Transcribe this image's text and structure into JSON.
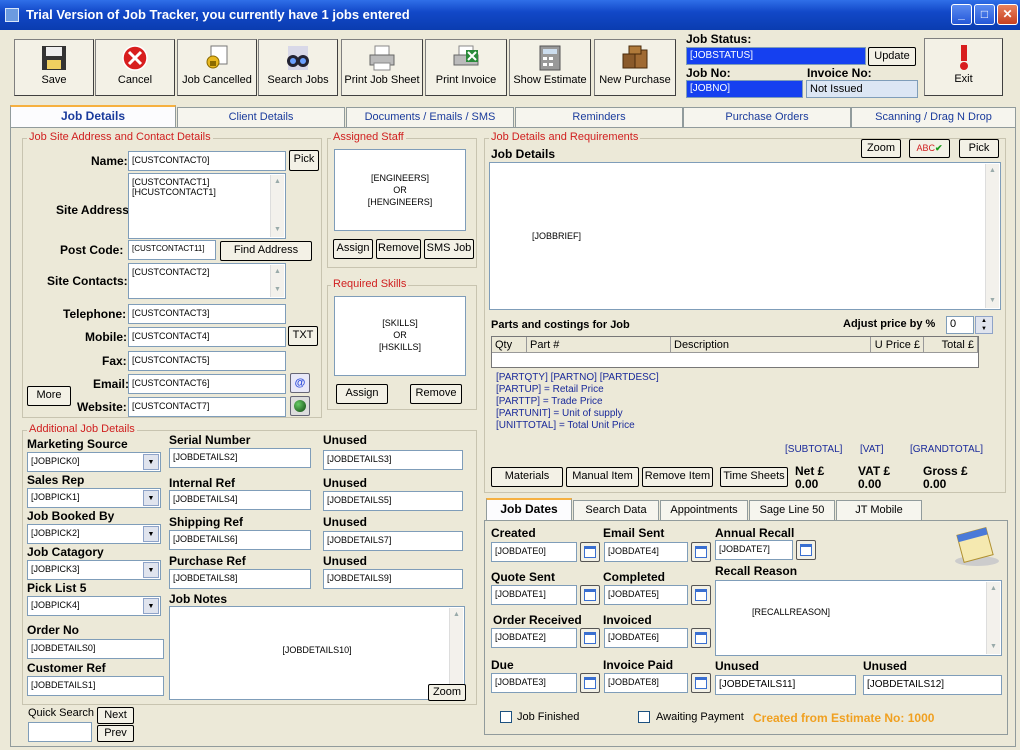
{
  "window": {
    "title": "Trial Version of Job Tracker, you currently have 1 jobs entered",
    "min": "_",
    "max": "□",
    "close": "✕"
  },
  "toolbar": {
    "save": "Save",
    "cancel": "Cancel",
    "job_cancelled": "Job Cancelled",
    "search_jobs": "Search Jobs",
    "print_job_sheet": "Print Job Sheet",
    "print_invoice": "Print Invoice",
    "show_estimate": "Show Estimate",
    "new_purchase": "New Purchase",
    "exit": "Exit"
  },
  "status": {
    "job_status_label": "Job Status:",
    "job_status_value": "[JOBSTATUS]",
    "update": "Update",
    "job_no_label": "Job No:",
    "job_no_value": "[JOBNO]",
    "invoice_no_label": "Invoice No:",
    "invoice_no_value": "Not Issued"
  },
  "tabs": [
    "Job Details",
    "Client Details",
    "Documents / Emails / SMS",
    "Reminders",
    "Purchase Orders",
    "Scanning / Drag N Drop"
  ],
  "site": {
    "title": "Job Site Address and Contact Details",
    "name_label": "Name:",
    "name": "[CUSTCONTACT0]",
    "pick": "Pick",
    "site_address_label": "Site Address",
    "addr1": "[CUSTCONTACT1]",
    "addr2": "[HCUSTCONTACT1]",
    "postcode_label": "Post Code:",
    "postcode": "[CUSTCONTACT11]",
    "find_address": "Find Address",
    "site_contacts_label": "Site Contacts:",
    "site_contacts": "[CUSTCONTACT2]",
    "telephone_label": "Telephone:",
    "telephone": "[CUSTCONTACT3]",
    "mobile_label": "Mobile:",
    "mobile": "[CUSTCONTACT4]",
    "txt": "TXT",
    "fax_label": "Fax:",
    "fax": "[CUSTCONTACT5]",
    "email_label": "Email:",
    "email": "[CUSTCONTACT6]",
    "website_label": "Website:",
    "website": "[CUSTCONTACT7]",
    "more": "More"
  },
  "staff": {
    "title": "Assigned Staff",
    "l1": "[ENGINEERS]",
    "l2": "OR",
    "l3": "[HENGINEERS]",
    "assign": "Assign",
    "remove": "Remove",
    "sms_job": "SMS Job"
  },
  "skills": {
    "title": "Required Skills",
    "l1": "[SKILLS]",
    "l2": "OR",
    "l3": "[HSKILLS]",
    "assign": "Assign",
    "remove": "Remove"
  },
  "additional": {
    "title": "Additional Job Details",
    "marketing_label": "Marketing Source",
    "marketing": "[JOBPICK0]",
    "sales_label": "Sales Rep",
    "sales": "[JOBPICK1]",
    "booked_label": "Job Booked By",
    "booked": "[JOBPICK2]",
    "category_label": "Job Catagory",
    "category": "[JOBPICK3]",
    "pick5_label": "Pick List 5",
    "pick5": "[JOBPICK4]",
    "order_label": "Order No",
    "order": "[JOBDETAILS0]",
    "customer_ref_label": "Customer Ref",
    "customer_ref": "[JOBDETAILS1]",
    "serial_label": "Serial Number",
    "serial": "[JOBDETAILS2]",
    "internal_label": "Internal Ref",
    "internal": "[JOBDETAILS4]",
    "shipping_label": "Shipping Ref",
    "shipping": "[JOBDETAILS6]",
    "purchase_label": "Purchase Ref",
    "purchase": "[JOBDETAILS8]",
    "unused_label": "Unused",
    "unused1": "[JOBDETAILS3]",
    "unused2": "[JOBDETAILS5]",
    "unused3": "[JOBDETAILS7]",
    "unused4": "[JOBDETAILS9]",
    "notes_label": "Job Notes",
    "notes": "[JOBDETAILS10]",
    "zoom": "Zoom"
  },
  "quick": {
    "label": "Quick Search",
    "next": "Next",
    "prev": "Prev"
  },
  "jobreq": {
    "title": "Job Details and Requirements",
    "job_details_label": "Job Details",
    "zoom": "Zoom",
    "abc": "ABC",
    "pick": "Pick",
    "brief": "[JOBBRIEF]"
  },
  "parts": {
    "title": "Parts and costings for Job",
    "adjust_label": "Adjust price by %",
    "adjust": "0",
    "headers": [
      "Qty",
      "Part #",
      "Description",
      "U Price £",
      "Total £"
    ],
    "legend": [
      "[PARTQTY]  [PARTNO]  [PARTDESC]",
      "[PARTUP] = Retail Price",
      "[PARTTP] = Trade Price",
      "[PARTUNIT] = Unit of supply",
      "[UNITTOTAL] = Total Unit Price"
    ],
    "subtotal": "[SUBTOTAL]",
    "vat": "[VAT]",
    "grandtotal": "[GRANDTOTAL]",
    "materials": "Materials",
    "manual_item": "Manual Item",
    "remove_item": "Remove Item",
    "time_sheets": "Time Sheets",
    "net_label": "Net £",
    "net": "0.00",
    "vat_label": "VAT £",
    "vat_value": "0.00",
    "gross_label": "Gross £",
    "gross": "0.00"
  },
  "subtabs": [
    "Job Dates",
    "Search Data",
    "Appointments",
    "Sage Line 50",
    "JT Mobile"
  ],
  "dates": {
    "created_label": "Created",
    "created": "[JOBDATE0]",
    "email_sent_label": "Email Sent",
    "email_sent": "[JOBDATE4]",
    "annual_label": "Annual Recall",
    "annual": "[JOBDATE7]",
    "quote_label": "Quote Sent",
    "quote": "[JOBDATE1]",
    "completed_label": "Completed",
    "completed": "[JOBDATE5]",
    "recall_reason_label": "Recall Reason",
    "recall_reason": "[RECALLREASON]",
    "order_received_label": "Order Received",
    "order_received": "[JOBDATE2]",
    "invoiced_label": "Invoiced",
    "invoiced": "[JOBDATE6]",
    "due_label": "Due",
    "due": "[JOBDATE3]",
    "invoice_paid_label": "Invoice Paid",
    "invoice_paid": "[JOBDATE8]",
    "unused_label": "Unused",
    "unused1": "[JOBDETAILS11]",
    "unused2": "[JOBDETAILS12]",
    "job_finished": "Job Finished",
    "awaiting": "Awaiting Payment",
    "estimate_text": "Created from Estimate  No:",
    "estimate_no": "1000"
  }
}
